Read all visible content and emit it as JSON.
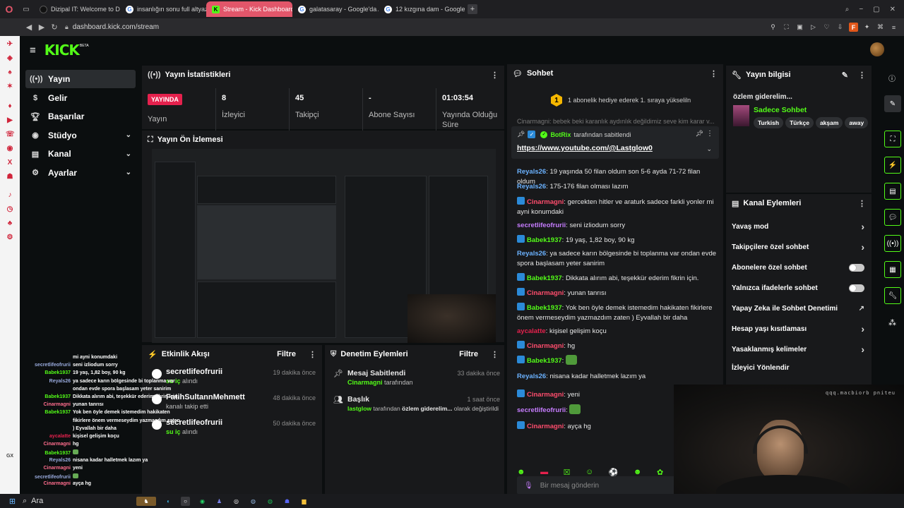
{
  "browser": {
    "tabs": [
      {
        "title": "Dizipal IT: Welcome to De",
        "icon": "dizipal-icon",
        "color": "#111111"
      },
      {
        "title": "insanlığın sonu full altyaz",
        "icon": "google-icon",
        "color": "#4285f4"
      },
      {
        "title": "Stream - Kick Dashboard",
        "icon": "kick-icon",
        "color": "#53fc18",
        "active": true
      },
      {
        "title": "galatasaray - Google'da A",
        "icon": "google-icon",
        "color": "#4285f4"
      },
      {
        "title": "12 kızgına dam - Google'd",
        "icon": "google-icon",
        "color": "#4285f4"
      }
    ],
    "url": "dashboard.kick.com/stream",
    "profile_letter": "F"
  },
  "kick": {
    "logo": "KICK",
    "beta": "BETA",
    "nav": [
      {
        "label": "Yayın",
        "icon": "broadcast-icon",
        "active": true,
        "expand": false
      },
      {
        "label": "Gelir",
        "icon": "dollar-icon",
        "active": false,
        "expand": false
      },
      {
        "label": "Başarılar",
        "icon": "trophy-icon",
        "active": false,
        "expand": false
      },
      {
        "label": "Stüdyo",
        "icon": "studio-icon",
        "active": false,
        "expand": true
      },
      {
        "label": "Kanal",
        "icon": "channel-icon",
        "active": false,
        "expand": true
      },
      {
        "label": "Ayarlar",
        "icon": "gear-icon",
        "active": false,
        "expand": true
      }
    ],
    "stats": {
      "title": "Yayın İstatistikleri",
      "live_badge": "YAYINDA",
      "live_label": "Yayın",
      "viewers_value": "8",
      "viewers_label": "İzleyici",
      "followers_value": "45",
      "followers_label": "Takipçi",
      "subs_value": "-",
      "subs_label": "Abone Sayısı",
      "duration_value": "01:03:54",
      "duration_label": "Yayında Olduğu Süre"
    },
    "preview": {
      "title": "Yayın Ön İzlemesi"
    },
    "activity": {
      "title": "Etkinlik Akışı",
      "filter": "Filtre",
      "items": [
        {
          "name": "secretlifeofrurii",
          "action_user": "su iç",
          "action": "alındı",
          "time": "19 dakika önce"
        },
        {
          "name": "FatihSultannMehmett",
          "action_user": "",
          "action": "kanalı takip etti",
          "time": "48 dakika önce"
        },
        {
          "name": "secretlifeofrurii",
          "action_user": "su iç",
          "action": "alındı",
          "time": "50 dakika önce"
        }
      ]
    },
    "moderation": {
      "title": "Denetim Eylemleri",
      "filter": "Filtre",
      "items": [
        {
          "title": "Mesaj Sabitlendi",
          "user": "Cinarmagni",
          "rest": "tarafından",
          "time": "33 dakika önce",
          "icon": "pin-icon"
        },
        {
          "title": "Başlık",
          "user": "lastglow",
          "rest": "tarafından",
          "highlight": "özlem giderelim...",
          "rest2": "olarak değiştirildi",
          "time": "1 saat önce",
          "icon": "people-icon"
        }
      ]
    },
    "chat": {
      "title": "Sohbet",
      "gift_rank": "1",
      "gift_text": "1 abonelik hediye ederek 1. sıraya yükseliln",
      "scroll_text": "Cinarmagni: bebek beki karanlık aydınlık değildimiz seve kim karar v...",
      "pinned_by": "BotRix",
      "pinned_suffix": "tarafından sabitlendi",
      "pinned_link": "https://www.youtube.com/@Lastglow0",
      "messages": [
        {
          "user": "Reyals26",
          "color": "#6bb2ff",
          "badge": false,
          "text": "19 yaşında 50 filan oldum son 5-6 ayda 71-72 filan oldum"
        },
        {
          "user": "Reyals26",
          "color": "#6bb2ff",
          "badge": false,
          "text": "175-176 filan olması lazım"
        },
        {
          "user": "Cinarmagni",
          "color": "#ff4d6d",
          "badge": true,
          "text": "gercekten hitler ve araturk sadece farkli yonler mi ayni konumdaki"
        },
        {
          "user": "secretlifeofrurii",
          "color": "#c77dff",
          "badge": false,
          "text": "seni izliodum sorry"
        },
        {
          "user": "Babek1937",
          "color": "#53fc18",
          "badge": true,
          "text": "19 yaş, 1,82 boy, 90 kg"
        },
        {
          "user": "Reyals26",
          "color": "#6bb2ff",
          "badge": false,
          "text": "ya sadece karın bölgesinde bi toplanma var ondan evde spora başlasam yeter sanirim"
        },
        {
          "user": "Babek1937",
          "color": "#53fc18",
          "badge": true,
          "text": "Dikkata alırım abi, teşekkür ederim fikrin için."
        },
        {
          "user": "Cinarmagni",
          "color": "#ff4d6d",
          "badge": true,
          "text": "yunan tanrısı"
        },
        {
          "user": "Babek1937",
          "color": "#53fc18",
          "badge": true,
          "text": "Yok ben öyle demek istemedim hakikaten fikirlere önem vermeseydim yazmazdım zaten ) Eyvallah bir daha"
        },
        {
          "user": "aycalatte",
          "color": "#e5214d",
          "badge": false,
          "text": "kişisel gelişim koçu"
        },
        {
          "user": "Cinarmagni",
          "color": "#ff4d6d",
          "badge": true,
          "text": "hg"
        },
        {
          "user": "Babek1937",
          "color": "#53fc18",
          "badge": true,
          "text": ""
        },
        {
          "user": "Reyals26",
          "color": "#6bb2ff",
          "badge": false,
          "text": "nisana kadar halletmek lazım ya"
        },
        {
          "user": "Cinarmagni",
          "color": "#ff4d6d",
          "badge": true,
          "text": "yeni"
        },
        {
          "user": "secretlifeofrurii",
          "color": "#c77dff",
          "badge": false,
          "text": ""
        },
        {
          "user": "Cinarmagni",
          "color": "#ff4d6d",
          "badge": true,
          "text": "ayça hg"
        }
      ],
      "input_placeholder": "Bir mesaj gönderin"
    },
    "stream_info": {
      "title": "Yayın bilgisi",
      "stream_title": "özlem giderelim...",
      "category": "Sadece Sohbet",
      "tags": [
        "Turkish",
        "Türkçe",
        "akşam",
        "away"
      ]
    },
    "channel_actions": {
      "title": "Kanal Eylemleri",
      "rows": [
        {
          "label": "Yavaş mod",
          "type": "arrow"
        },
        {
          "label": "Takipçilere özel sohbet",
          "type": "arrow"
        },
        {
          "label": "Abonelere özel sohbet",
          "type": "toggle"
        },
        {
          "label": "Yalnızca ifadelerle sohbet",
          "type": "toggle"
        },
        {
          "label": "Yapay Zeka ile Sohbet Denetimi",
          "type": "external"
        },
        {
          "label": "Hesap yaşı kısıtlaması",
          "type": "arrow"
        },
        {
          "label": "Yasaklanmış kelimeler",
          "type": "arrow"
        },
        {
          "label": "İzleyici Yönlendir",
          "type": "none"
        }
      ]
    }
  },
  "overlay_chat": [
    {
      "user": "",
      "text": "mi ayni konumdaki"
    },
    {
      "user": "secretlifeofrurii",
      "text": "seni izliodum sorry"
    },
    {
      "user": "Babek1937",
      "text": "19 yaş, 1,82 boy, 90 kg"
    },
    {
      "user": "Reyals26",
      "text": "ya sadece karın bölgesinde bi toplanma var"
    },
    {
      "user": "",
      "text": "ondan evde spora başlasam yeter sanirim"
    },
    {
      "user": "Babek1937",
      "text": "Dikkata alırım abi, teşekkür ederim fikrin için."
    },
    {
      "user": "Cinarmagni",
      "text": "yunan tanrısı"
    },
    {
      "user": "Babek1937",
      "text": "Yok ben öyle demek istemedim hakikaten"
    },
    {
      "user": "",
      "text": "fikirlere önem vermeseydim yazmazdım zaten"
    },
    {
      "user": "",
      "text": ") Eyvallah bir daha"
    },
    {
      "user": "aycalatte",
      "text": "kişisel gelişim koçu"
    },
    {
      "user": "Cinarmagni",
      "text": "hg"
    },
    {
      "user": "Babek1937",
      "text": ""
    },
    {
      "user": "Reyals26",
      "text": "nisana kadar halletmek lazım ya"
    },
    {
      "user": "Cinarmagni",
      "text": "yeni"
    },
    {
      "user": "secretlifeofrurii",
      "text": ""
    },
    {
      "user": "Cinarmagni",
      "text": "ayça hg"
    }
  ],
  "webcam_text": "qqq.macbiorb pniteu",
  "taskbar": {
    "search": "Ara"
  },
  "opera_side_extra": "GX"
}
